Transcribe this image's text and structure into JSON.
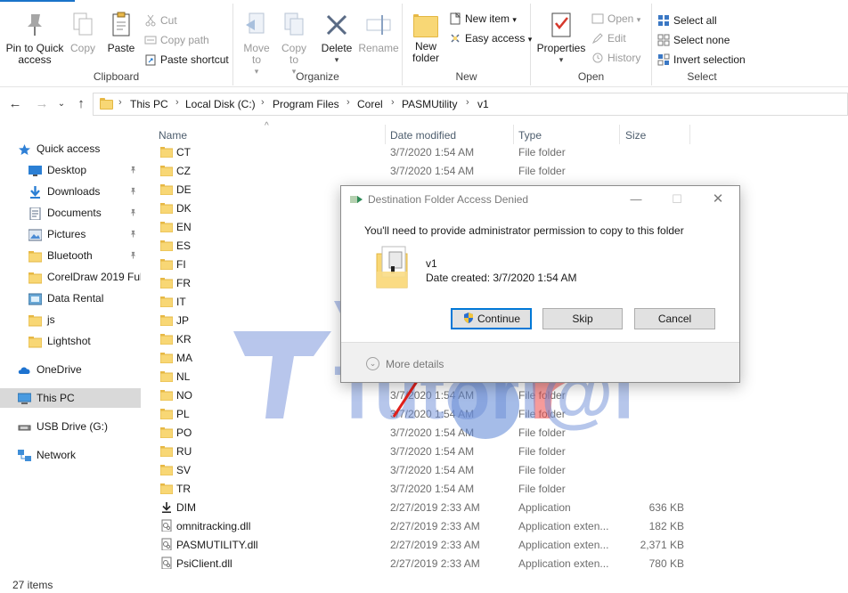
{
  "colors": {
    "accent": "#0078d7",
    "folder_yellow": "#f8d775",
    "selection_gray": "#d9d9d9",
    "watermark_blue": "#6f8fd8",
    "watermark_red": "#ef4b4b"
  },
  "ribbon": {
    "clipboard": {
      "label": "Clipboard",
      "pin": "Pin to Quick access",
      "copy": "Copy",
      "paste": "Paste",
      "cut": "Cut",
      "copy_path": "Copy path",
      "paste_shortcut": "Paste shortcut"
    },
    "organize": {
      "label": "Organize",
      "move_to": "Move to",
      "copy_to": "Copy to",
      "delete": "Delete",
      "rename": "Rename"
    },
    "new": {
      "label": "New",
      "new_folder": "New folder",
      "new_item": "New item",
      "easy_access": "Easy access"
    },
    "open": {
      "label": "Open",
      "properties": "Properties",
      "open": "Open",
      "edit": "Edit",
      "history": "History"
    },
    "select": {
      "label": "Select",
      "select_all": "Select all",
      "select_none": "Select none",
      "invert": "Invert selection"
    }
  },
  "address": {
    "crumbs": [
      "This PC",
      "Local Disk (C:)",
      "Program Files",
      "Corel",
      "PASMUtility",
      "v1"
    ]
  },
  "navpane": {
    "items": [
      {
        "label": "Quick access",
        "icon": "star-icon",
        "pinned": false
      },
      {
        "label": "Desktop",
        "icon": "desktop-icon",
        "pinned": true
      },
      {
        "label": "Downloads",
        "icon": "download-icon",
        "pinned": true
      },
      {
        "label": "Documents",
        "icon": "documents-icon",
        "pinned": true
      },
      {
        "label": "Pictures",
        "icon": "pictures-icon",
        "pinned": true
      },
      {
        "label": "Bluetooth",
        "icon": "folder-icon",
        "pinned": true
      },
      {
        "label": "CorelDraw 2019 Full",
        "icon": "folder-icon",
        "pinned": false
      },
      {
        "label": "Data Rental",
        "icon": "drive-icon",
        "pinned": false
      },
      {
        "label": "js",
        "icon": "folder-icon",
        "pinned": false
      },
      {
        "label": "Lightshot",
        "icon": "folder-icon",
        "pinned": false
      },
      {
        "label": "OneDrive",
        "icon": "cloud-icon",
        "pinned": false
      },
      {
        "label": "This PC",
        "icon": "computer-icon",
        "pinned": false
      },
      {
        "label": "USB Drive (G:)",
        "icon": "usb-icon",
        "pinned": false
      },
      {
        "label": "Network",
        "icon": "network-icon",
        "pinned": false
      }
    ],
    "pin_glyph": "📌"
  },
  "columns": {
    "name": "Name",
    "date": "Date modified",
    "type": "Type",
    "size": "Size"
  },
  "files": [
    {
      "name": "CT",
      "date": "3/7/2020 1:54 AM",
      "type": "File folder",
      "size": "",
      "icon": "folder-icon"
    },
    {
      "name": "CZ",
      "date": "3/7/2020 1:54 AM",
      "type": "File folder",
      "size": "",
      "icon": "folder-icon"
    },
    {
      "name": "DE",
      "date": "",
      "type": "",
      "size": "",
      "icon": "folder-icon"
    },
    {
      "name": "DK",
      "date": "",
      "type": "",
      "size": "",
      "icon": "folder-icon"
    },
    {
      "name": "EN",
      "date": "",
      "type": "",
      "size": "",
      "icon": "folder-icon"
    },
    {
      "name": "ES",
      "date": "",
      "type": "",
      "size": "",
      "icon": "folder-icon"
    },
    {
      "name": "FI",
      "date": "",
      "type": "",
      "size": "",
      "icon": "folder-icon"
    },
    {
      "name": "FR",
      "date": "",
      "type": "",
      "size": "",
      "icon": "folder-icon"
    },
    {
      "name": "IT",
      "date": "",
      "type": "",
      "size": "",
      "icon": "folder-icon"
    },
    {
      "name": "JP",
      "date": "",
      "type": "",
      "size": "",
      "icon": "folder-icon"
    },
    {
      "name": "KR",
      "date": "",
      "type": "",
      "size": "",
      "icon": "folder-icon"
    },
    {
      "name": "MA",
      "date": "",
      "type": "",
      "size": "",
      "icon": "folder-icon"
    },
    {
      "name": "NL",
      "date": "",
      "type": "",
      "size": "",
      "icon": "folder-icon"
    },
    {
      "name": "NO",
      "date": "3/7/2020 1:54 AM",
      "type": "File folder",
      "size": "",
      "icon": "folder-icon"
    },
    {
      "name": "PL",
      "date": "3/7/2020 1:54 AM",
      "type": "File folder",
      "size": "",
      "icon": "folder-icon"
    },
    {
      "name": "PO",
      "date": "3/7/2020 1:54 AM",
      "type": "File folder",
      "size": "",
      "icon": "folder-icon"
    },
    {
      "name": "RU",
      "date": "3/7/2020 1:54 AM",
      "type": "File folder",
      "size": "",
      "icon": "folder-icon"
    },
    {
      "name": "SV",
      "date": "3/7/2020 1:54 AM",
      "type": "File folder",
      "size": "",
      "icon": "folder-icon"
    },
    {
      "name": "TR",
      "date": "3/7/2020 1:54 AM",
      "type": "File folder",
      "size": "",
      "icon": "folder-icon"
    },
    {
      "name": "DIM",
      "date": "2/27/2019 2:33 AM",
      "type": "Application",
      "size": "636 KB",
      "icon": "download-arrow-icon"
    },
    {
      "name": "omnitracking.dll",
      "date": "2/27/2019 2:33 AM",
      "type": "Application exten...",
      "size": "182 KB",
      "icon": "dll-file-icon"
    },
    {
      "name": "PASMUTILITY.dll",
      "date": "2/27/2019 2:33 AM",
      "type": "Application exten...",
      "size": "2,371 KB",
      "icon": "dll-file-icon"
    },
    {
      "name": "PsiClient.dll",
      "date": "2/27/2019 2:33 AM",
      "type": "Application exten...",
      "size": "780 KB",
      "icon": "dll-file-icon"
    }
  ],
  "status": {
    "item_count": "27 items"
  },
  "dialog": {
    "title": "Destination Folder Access Denied",
    "message": "You'll need to provide administrator permission to copy to this folder",
    "file_name": "v1",
    "file_date": "Date created: 3/7/2020 1:54 AM",
    "continue": "Continue",
    "skip": "Skip",
    "cancel": "Cancel",
    "more_details": "More details"
  },
  "watermark": {
    "line1": "Online",
    "line2": "Tutori@l"
  }
}
